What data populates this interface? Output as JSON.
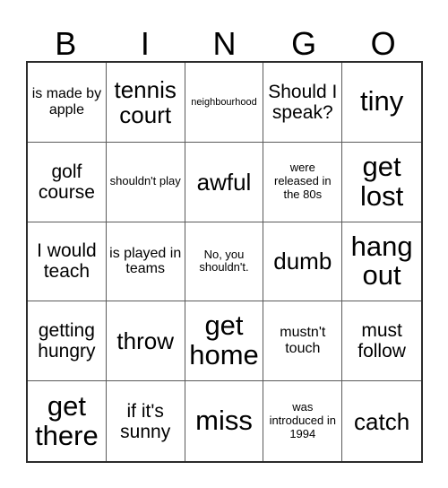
{
  "card": {
    "header_letters": [
      "B",
      "I",
      "N",
      "G",
      "O"
    ],
    "columns": 5,
    "rows": 5,
    "colors": {
      "page_background": "#ffffff",
      "cell_background": "#ffffff",
      "text": "#000000",
      "outer_border": "#2b2b2b",
      "inner_gridline": "#5a5a5a"
    },
    "cells": [
      {
        "text": "is made by apple",
        "size": "md"
      },
      {
        "text": "tennis court",
        "size": "xl"
      },
      {
        "text": "neighbourhood",
        "size": "xs"
      },
      {
        "text": "Should I speak?",
        "size": "lg"
      },
      {
        "text": "tiny",
        "size": "xxl"
      },
      {
        "text": "golf course",
        "size": "lg"
      },
      {
        "text": "shouldn't play",
        "size": "sm"
      },
      {
        "text": "awful",
        "size": "xl"
      },
      {
        "text": "were released in the 80s",
        "size": "sm"
      },
      {
        "text": "get lost",
        "size": "xxl"
      },
      {
        "text": "I would teach",
        "size": "lg"
      },
      {
        "text": "is played in teams",
        "size": "md"
      },
      {
        "text": "No, you shouldn't.",
        "size": "sm"
      },
      {
        "text": "dumb",
        "size": "xl"
      },
      {
        "text": "hang out",
        "size": "xxl"
      },
      {
        "text": "getting hungry",
        "size": "lg"
      },
      {
        "text": "throw",
        "size": "xl"
      },
      {
        "text": "get home",
        "size": "xxl"
      },
      {
        "text": "mustn't touch",
        "size": "md"
      },
      {
        "text": "must follow",
        "size": "lg"
      },
      {
        "text": "get there",
        "size": "xxl"
      },
      {
        "text": "if it's sunny",
        "size": "lg"
      },
      {
        "text": "miss",
        "size": "xxl"
      },
      {
        "text": "was introduced in 1994",
        "size": "sm"
      },
      {
        "text": "catch",
        "size": "xl"
      }
    ]
  }
}
